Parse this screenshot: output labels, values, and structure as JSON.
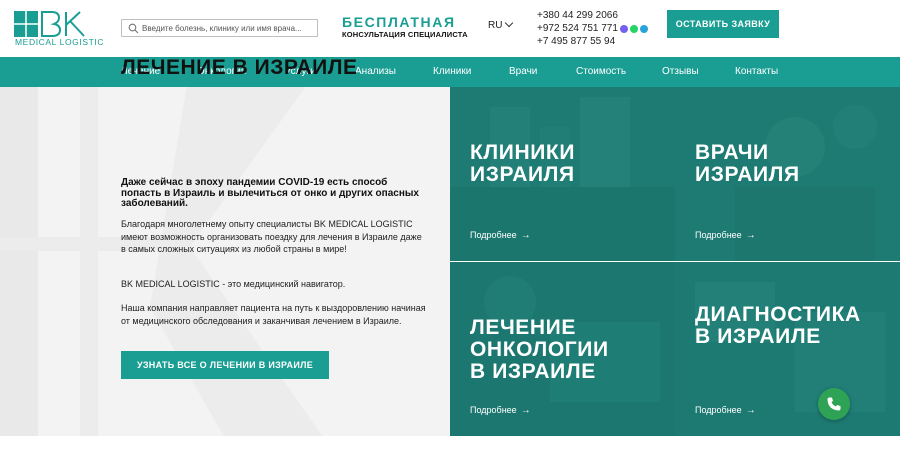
{
  "header": {
    "logo_letters": "BK",
    "logo_sub": "MEDICAL LOGISTIC",
    "search_placeholder": "Введите болезнь, клинику или имя врача...",
    "promo_title": "БЕСПЛАТНАЯ",
    "promo_sub": "КОНСУЛЬТАЦИЯ СПЕЦИАЛИСТА",
    "lang": "RU",
    "phones": [
      "+380 44 299 2066",
      "+972 524 751 771",
      "+7 495 877 55 94"
    ],
    "cta_label": "ОСТАВИТЬ ЗАЯВКУ"
  },
  "nav": {
    "items": [
      "Лечение",
      "Онкология",
      "Услуги",
      "Анализы",
      "Клиники",
      "Врачи",
      "Стоимость",
      "Отзывы",
      "Контакты"
    ]
  },
  "hero": {
    "title": "ЛЕЧЕНИЕ В ИЗРАИЛЕ",
    "lead": "Даже сейчас в эпоху пандемии COVID-19 есть способ попасть в Израиль и вылечиться от онко и других опасных заболеваний.",
    "p1": "Благодаря многолетнему опыту специалисты BK MEDICAL LOGISTIC имеют возможность организовать поездку для лечения в Израиле даже в самых сложных ситуациях из любой страны в мире!",
    "p2": "BK MEDICAL LOGISTIC - это медицинский навигатор.",
    "p3": "Наша компания направляет пациента на путь к выздоровлению начиная от медицинского обследования и заканчивая лечением в Израиле.",
    "button_label": "УЗНАТЬ ВСЕ О ЛЕЧЕНИИ В ИЗРАИЛЕ"
  },
  "tiles": [
    {
      "title": "КЛИНИКИ\nИЗРАИЛЯ",
      "more": "Подробнее"
    },
    {
      "title": "ВРАЧИ\nИЗРАИЛЯ",
      "more": "Подробнее"
    },
    {
      "title": "ЛЕЧЕНИЕ\nОНКОЛОГИИ\nВ ИЗРАИЛЕ",
      "more": "Подробнее"
    },
    {
      "title": "ДИАГНОСТИКА\nВ ИЗРАИЛЕ",
      "more": "Подробнее"
    }
  ],
  "colors": {
    "accent": "#1a9e93",
    "tile_overlay": "#0f6e66",
    "call_button": "#2ea356"
  }
}
